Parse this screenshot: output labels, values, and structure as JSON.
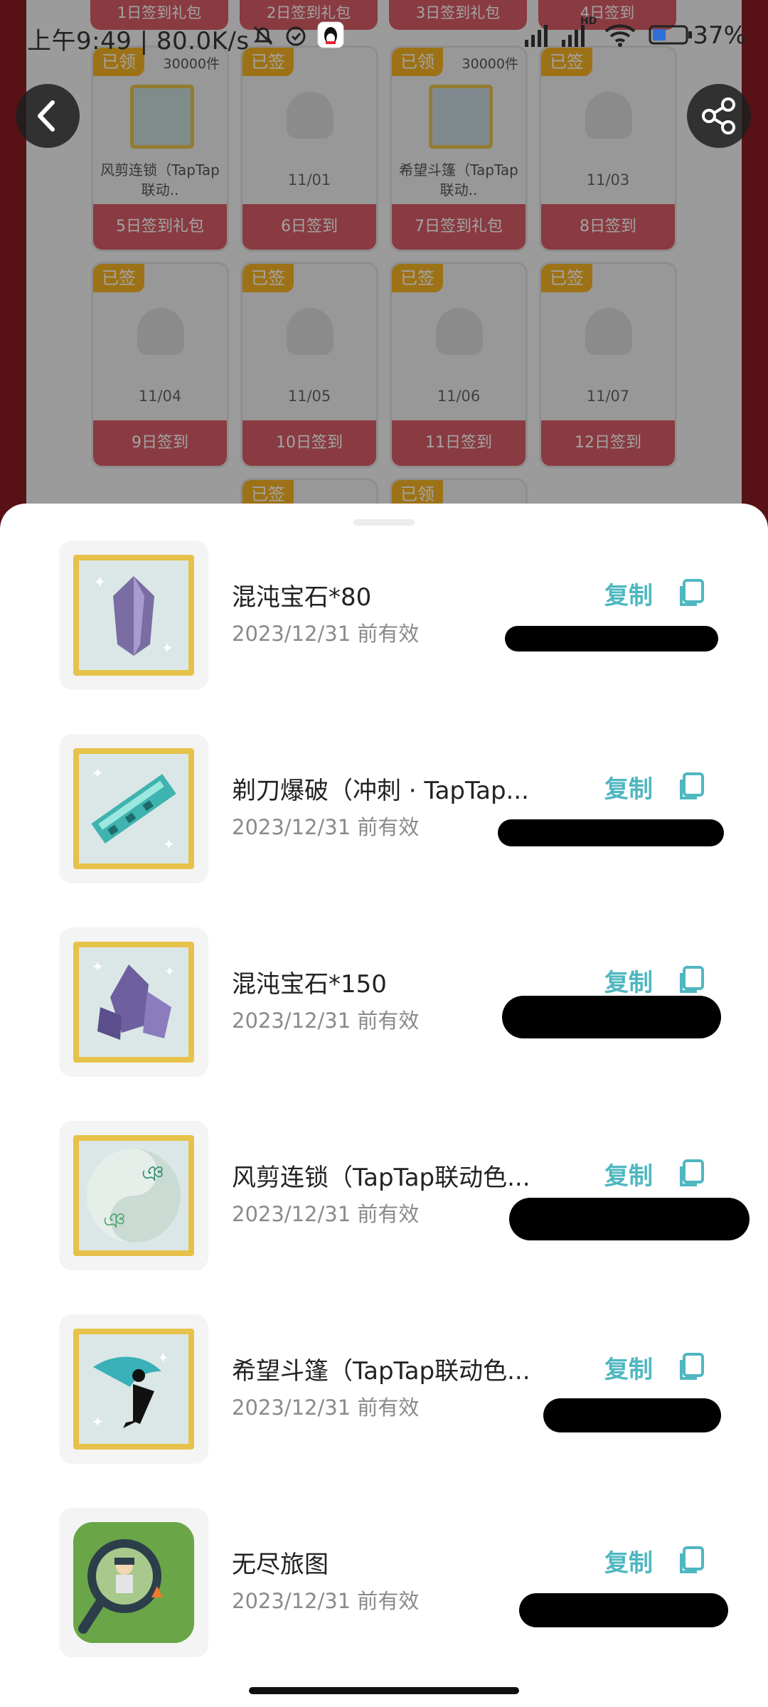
{
  "status_bar": {
    "time_speed": "上午9:49 | 80.0K/s",
    "battery": "37%",
    "network_label": "HD"
  },
  "top_strip": [
    "1日签到礼包",
    "2日签到礼包",
    "3日签到礼包",
    "4日签到"
  ],
  "calendar": {
    "row1": [
      {
        "tag": "已领",
        "count": "30000件",
        "name": "风剪连锁（TapTap联动..",
        "footer": "5日签到礼包"
      },
      {
        "tag": "已签",
        "date": "11/01",
        "footer": "6日签到"
      },
      {
        "tag": "已领",
        "count": "30000件",
        "name": "希望斗篷（TapTap联动..",
        "footer": "7日签到礼包"
      },
      {
        "tag": "已签",
        "date": "11/03",
        "footer": "8日签到"
      }
    ],
    "row2": [
      {
        "tag": "已签",
        "date": "11/04",
        "footer": "9日签到"
      },
      {
        "tag": "已签",
        "date": "11/05",
        "footer": "10日签到"
      },
      {
        "tag": "已签",
        "date": "11/06",
        "footer": "11日签到"
      },
      {
        "tag": "已签",
        "date": "11/07",
        "footer": "12日签到"
      }
    ],
    "row3_tags": [
      "已签",
      "已领"
    ]
  },
  "gifts": [
    {
      "title": "混沌宝石*80",
      "expiry": "2023/12/31 前有效",
      "copy": "复制",
      "icon": "purple-gem-icon"
    },
    {
      "title": "剃刀爆破（冲刺 · TapTap...",
      "expiry": "2023/12/31 前有效",
      "copy": "复制",
      "icon": "razor-blast-icon"
    },
    {
      "title": "混沌宝石*150",
      "expiry": "2023/12/31 前有效",
      "copy": "复制",
      "icon": "purple-gem-cluster-icon"
    },
    {
      "title": "风剪连锁（TapTap联动色...",
      "expiry": "2023/12/31 前有效",
      "copy": "复制",
      "icon": "wind-chain-icon"
    },
    {
      "title": "希望斗篷（TapTap联动色...",
      "expiry": "2023/12/31 前有效",
      "copy": "复制",
      "icon": "hope-cloak-icon"
    },
    {
      "title": "无尽旅图",
      "expiry": "2023/12/31 前有效",
      "copy": "复制",
      "icon": "endless-map-icon"
    }
  ],
  "colors": {
    "accent": "#4fb7c0",
    "tag": "#f6b323",
    "footer_red": "#d65d66"
  }
}
